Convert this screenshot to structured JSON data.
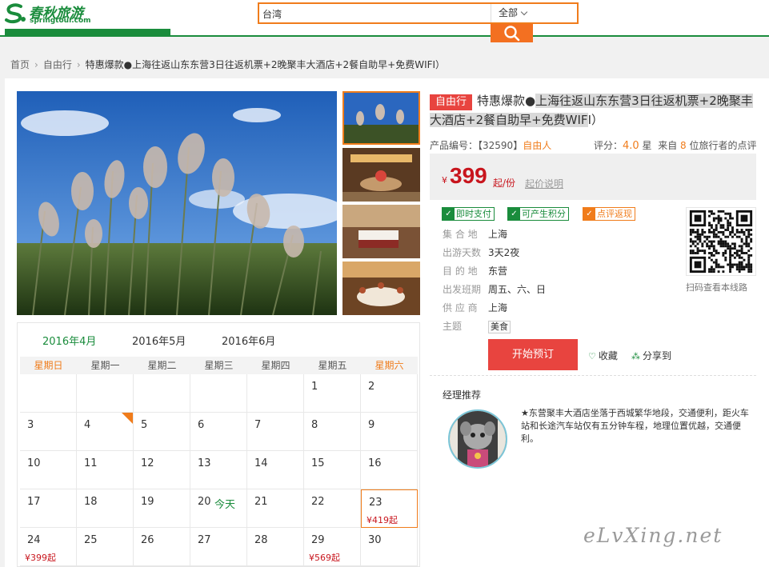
{
  "brand": {
    "name": "春秋旅游",
    "domain": "springtour.com"
  },
  "search": {
    "value": "台湾",
    "scope": "全部"
  },
  "breadcrumb": {
    "home": "首页",
    "category": "自由行",
    "current": "特惠爆款●上海往返山东东营3日往返机票+2晚聚丰大酒店+2餐自助早+免费WIFI）"
  },
  "product": {
    "tag": "自由行",
    "title_prefix": "特惠爆款●",
    "title_highlight_1": "上海往返山东东营3日往返机票+2晚",
    "title_highlight_2": "聚丰大酒店+2餐自助早+免费WIF",
    "title_end": "I）",
    "code_label": "产品编号：",
    "code": "【32590】",
    "type_label": "自由人",
    "rating_label": "评分：",
    "rating_value": "4.0",
    "rating_unit": "星",
    "reviews_prefix": "来自",
    "reviews_count": "8",
    "reviews_suffix": "位旅行者的点评",
    "price_symbol": "¥",
    "price": "399",
    "price_unit": "起/份",
    "price_explain": "起价说明"
  },
  "badges": [
    {
      "label": "即时支付",
      "color": "#1a8c3c"
    },
    {
      "label": "可产生积分",
      "color": "#1a8c3c"
    },
    {
      "label": "点评返现",
      "color": "#f07c1b"
    }
  ],
  "attrs": [
    {
      "key": "集 合 地",
      "value": "上海"
    },
    {
      "key": "出游天数",
      "value": "3天2夜"
    },
    {
      "key": "目 的 地",
      "value": "东营"
    },
    {
      "key": "出发班期",
      "value": "周五、六、日"
    },
    {
      "key": "供 应 商",
      "value": "上海"
    }
  ],
  "theme": {
    "key": "主题",
    "value": "美食"
  },
  "qr_caption": "扫码查看本线路",
  "actions": {
    "book": "开始预订",
    "favorite": "收藏",
    "share": "分享到"
  },
  "manager": {
    "title": "经理推荐",
    "text": "★东营聚丰大酒店坐落于西城繁华地段，交通便利，距火车站和长途汽车站仅有五分钟车程，地理位置优越，交通便利。"
  },
  "calendar": {
    "months": [
      "2016年4月",
      "2016年5月",
      "2016年6月"
    ],
    "weekdays": [
      "星期日",
      "星期一",
      "星期二",
      "星期三",
      "星期四",
      "星期五",
      "星期六"
    ],
    "today_label": "今天",
    "rows": [
      [
        {
          "d": ""
        },
        {
          "d": ""
        },
        {
          "d": ""
        },
        {
          "d": ""
        },
        {
          "d": ""
        },
        {
          "d": "1"
        },
        {
          "d": "2"
        }
      ],
      [
        {
          "d": "3"
        },
        {
          "d": "4",
          "flag": true
        },
        {
          "d": "5"
        },
        {
          "d": "6"
        },
        {
          "d": "7"
        },
        {
          "d": "8"
        },
        {
          "d": "9"
        }
      ],
      [
        {
          "d": "10"
        },
        {
          "d": "11"
        },
        {
          "d": "12"
        },
        {
          "d": "13"
        },
        {
          "d": "14"
        },
        {
          "d": "15"
        },
        {
          "d": "16"
        }
      ],
      [
        {
          "d": "17"
        },
        {
          "d": "18"
        },
        {
          "d": "19"
        },
        {
          "d": "20",
          "today": true
        },
        {
          "d": "21"
        },
        {
          "d": "22"
        },
        {
          "d": "23",
          "price": "¥419起",
          "selected": true
        }
      ],
      [
        {
          "d": "24",
          "price": "¥399起"
        },
        {
          "d": "25"
        },
        {
          "d": "26"
        },
        {
          "d": "27"
        },
        {
          "d": "28"
        },
        {
          "d": "29",
          "price": "¥569起"
        },
        {
          "d": "30"
        }
      ]
    ]
  },
  "watermark": "eLvXing.net",
  "colors": {
    "brand_green": "#1a8c3c",
    "accent_orange": "#f07c1b",
    "price_red": "#c8151d",
    "button_red": "#e8443f"
  }
}
